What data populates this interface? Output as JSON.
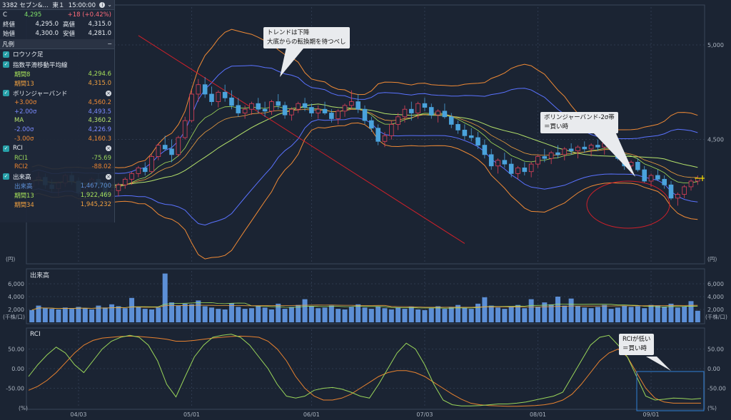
{
  "header": {
    "title": "3382 セブン&…",
    "market": "東１",
    "time": "15:00:00",
    "last_label": "C",
    "last": "4,295",
    "change": "+18 (+0.42%)",
    "close_label": "終値",
    "close": "4,295.0",
    "high_label": "高値",
    "high": "4,315.0",
    "open_label": "始値",
    "open": "4,300.0",
    "low_label": "安値",
    "low": "4,281.0"
  },
  "legend": {
    "title": "凡例",
    "candle": "ロウソク足",
    "ema": {
      "label": "指数平滑移動平均線",
      "p8_label": "期間8",
      "p8": "4,294.6",
      "p13_label": "期間13",
      "p13": "4,315.0"
    },
    "bb": {
      "label": "ボリンジャーバンド",
      "p3_label": "+3.00σ",
      "p3": "4,560.2",
      "p2_label": "+2.00σ",
      "p2": "4,493.5",
      "ma_label": "MA",
      "ma": "4,360.2",
      "m2_label": "-2.00σ",
      "m2": "4,226.9",
      "m3_label": "-3.00σ",
      "m3": "4,160.3"
    },
    "rci": {
      "label": "RCI",
      "r1_label": "RCI1",
      "r1": "-75.69",
      "r2_label": "RCI2",
      "r2": "-88.02"
    },
    "vol": {
      "label": "出来高",
      "v_label": "出来高",
      "v": "1,467,700",
      "p13_label": "期間13",
      "p13": "1,922,469",
      "p34_label": "期間34",
      "p34": "1,945,232"
    }
  },
  "colors": {
    "bg": "#1b2433",
    "up": "#e0415a",
    "down": "#4aa3dc",
    "bb3": "#f08a35",
    "bb2": "#5a72ff",
    "ma": "#b5e36b",
    "ema8": "#a6e05a",
    "ema13": "#f0a040",
    "rci1": "#9ad65a",
    "rci2": "#e8822f",
    "vol": "#5c8fd6",
    "trend": "#d0202a"
  },
  "callouts": {
    "trend": [
      "トレンドは下降",
      "大底からの転換期を待つべし"
    ],
    "bb": [
      "ボリンジャーバンド-2σ帯",
      "＝買い時"
    ],
    "rci": [
      "RCIが低い",
      "＝買い時"
    ]
  },
  "panels": {
    "volume_title": "出来高",
    "rci_title": "RCI",
    "price_unit": "(円)",
    "volume_unit": "(千株/口)",
    "rci_unit": "(%)"
  },
  "chart_data": {
    "type": "candlestick",
    "x_ticks": [
      "04/03",
      "05/01",
      "06/01",
      "07/03",
      "08/01",
      "09/01"
    ],
    "price_axis": {
      "ticks": [
        4500,
        5000
      ],
      "tick_labels": [
        "4,500",
        "5,000"
      ],
      "range": [
        3850,
        5200
      ]
    },
    "candles": [
      [
        4250,
        4300,
        4230,
        4280
      ],
      [
        4290,
        4330,
        4260,
        4300
      ],
      [
        4300,
        4320,
        4240,
        4260
      ],
      [
        4260,
        4290,
        4220,
        4240
      ],
      [
        4240,
        4280,
        4200,
        4270
      ],
      [
        4270,
        4320,
        4250,
        4310
      ],
      [
        4310,
        4330,
        4260,
        4280
      ],
      [
        4280,
        4300,
        4200,
        4220
      ],
      [
        4220,
        4260,
        4190,
        4250
      ],
      [
        4250,
        4300,
        4230,
        4290
      ],
      [
        4290,
        4320,
        4240,
        4260
      ],
      [
        4260,
        4280,
        4190,
        4200
      ],
      [
        4200,
        4240,
        4170,
        4230
      ],
      [
        4230,
        4270,
        4200,
        4260
      ],
      [
        4260,
        4300,
        4240,
        4290
      ],
      [
        4290,
        4330,
        4260,
        4320
      ],
      [
        4320,
        4360,
        4300,
        4350
      ],
      [
        4350,
        4380,
        4310,
        4330
      ],
      [
        4330,
        4420,
        4320,
        4410
      ],
      [
        4410,
        4480,
        4390,
        4470
      ],
      [
        4470,
        4520,
        4440,
        4450
      ],
      [
        4450,
        4500,
        4380,
        4420
      ],
      [
        4420,
        4520,
        4410,
        4510
      ],
      [
        4510,
        4620,
        4500,
        4600
      ],
      [
        4600,
        4760,
        4590,
        4740
      ],
      [
        4740,
        4820,
        4700,
        4790
      ],
      [
        4790,
        4830,
        4720,
        4740
      ],
      [
        4740,
        4780,
        4680,
        4700
      ],
      [
        4700,
        4760,
        4670,
        4750
      ],
      [
        4750,
        4790,
        4700,
        4720
      ],
      [
        4720,
        4760,
        4660,
        4680
      ],
      [
        4680,
        4720,
        4620,
        4640
      ],
      [
        4640,
        4680,
        4610,
        4660
      ],
      [
        4660,
        4700,
        4630,
        4690
      ],
      [
        4690,
        4720,
        4640,
        4660
      ],
      [
        4660,
        4700,
        4620,
        4650
      ],
      [
        4650,
        4710,
        4630,
        4700
      ],
      [
        4700,
        4740,
        4660,
        4680
      ],
      [
        4680,
        4700,
        4610,
        4630
      ],
      [
        4630,
        4670,
        4600,
        4660
      ],
      [
        4660,
        4700,
        4640,
        4690
      ],
      [
        4690,
        4720,
        4650,
        4670
      ],
      [
        4670,
        4690,
        4620,
        4640
      ],
      [
        4640,
        4680,
        4610,
        4660
      ],
      [
        4660,
        4700,
        4630,
        4640
      ],
      [
        4640,
        4660,
        4590,
        4610
      ],
      [
        4610,
        4660,
        4580,
        4650
      ],
      [
        4650,
        4690,
        4620,
        4680
      ],
      [
        4680,
        4760,
        4660,
        4700
      ],
      [
        4700,
        4740,
        4640,
        4660
      ],
      [
        4660,
        4680,
        4580,
        4600
      ],
      [
        4600,
        4620,
        4540,
        4560
      ],
      [
        4560,
        4580,
        4470,
        4490
      ],
      [
        4490,
        4540,
        4460,
        4520
      ],
      [
        4520,
        4600,
        4500,
        4580
      ],
      [
        4580,
        4640,
        4550,
        4620
      ],
      [
        4620,
        4680,
        4590,
        4660
      ],
      [
        4660,
        4700,
        4600,
        4640
      ],
      [
        4640,
        4700,
        4610,
        4690
      ],
      [
        4690,
        4720,
        4650,
        4670
      ],
      [
        4670,
        4690,
        4610,
        4630
      ],
      [
        4630,
        4660,
        4590,
        4650
      ],
      [
        4650,
        4690,
        4610,
        4620
      ],
      [
        4620,
        4640,
        4560,
        4580
      ],
      [
        4580,
        4600,
        4530,
        4550
      ],
      [
        4550,
        4580,
        4500,
        4520
      ],
      [
        4520,
        4560,
        4490,
        4510
      ],
      [
        4510,
        4540,
        4450,
        4470
      ],
      [
        4470,
        4500,
        4400,
        4420
      ],
      [
        4420,
        4450,
        4340,
        4360
      ],
      [
        4360,
        4400,
        4320,
        4390
      ],
      [
        4390,
        4430,
        4350,
        4370
      ],
      [
        4370,
        4400,
        4300,
        4320
      ],
      [
        4320,
        4360,
        4290,
        4350
      ],
      [
        4350,
        4380,
        4310,
        4330
      ],
      [
        4330,
        4380,
        4300,
        4370
      ],
      [
        4370,
        4420,
        4350,
        4410
      ],
      [
        4410,
        4450,
        4380,
        4400
      ],
      [
        4400,
        4440,
        4370,
        4430
      ],
      [
        4430,
        4470,
        4400,
        4420
      ],
      [
        4420,
        4460,
        4390,
        4450
      ],
      [
        4450,
        4480,
        4420,
        4440
      ],
      [
        4440,
        4470,
        4400,
        4460
      ],
      [
        4460,
        4490,
        4430,
        4450
      ],
      [
        4450,
        4480,
        4410,
        4470
      ],
      [
        4470,
        4500,
        4440,
        4460
      ],
      [
        4460,
        4490,
        4420,
        4480
      ],
      [
        4480,
        4520,
        4440,
        4450
      ],
      [
        4450,
        4470,
        4390,
        4400
      ],
      [
        4400,
        4420,
        4340,
        4360
      ],
      [
        4360,
        4390,
        4320,
        4380
      ],
      [
        4380,
        4400,
        4330,
        4340
      ],
      [
        4340,
        4360,
        4270,
        4280
      ],
      [
        4280,
        4320,
        4250,
        4310
      ],
      [
        4310,
        4340,
        4280,
        4290
      ],
      [
        4290,
        4310,
        4240,
        4260
      ],
      [
        4260,
        4280,
        4180,
        4190
      ],
      [
        4190,
        4220,
        4150,
        4210
      ],
      [
        4210,
        4260,
        4190,
        4250
      ],
      [
        4250,
        4290,
        4230,
        4280
      ],
      [
        4280,
        4310,
        4260,
        4295
      ]
    ],
    "volume": {
      "ticks": [
        2000,
        4000,
        6000
      ],
      "tick_labels": [
        "2,000",
        "4,000",
        "6,000"
      ],
      "range": [
        0,
        8000
      ],
      "values": [
        1900,
        2600,
        2200,
        2100,
        2000,
        2300,
        2100,
        2400,
        2200,
        2000,
        2600,
        2300,
        2800,
        2500,
        2200,
        3800,
        2400,
        2100,
        2000,
        2300,
        7600,
        3100,
        2600,
        2900,
        2800,
        3400,
        2500,
        2300,
        2100,
        2000,
        3000,
        2400,
        2100,
        2200,
        2600,
        2300,
        2000,
        2900,
        2100,
        2400,
        2700,
        3600,
        2500,
        2200,
        2300,
        2600,
        2100,
        2000,
        2400,
        2800,
        2300,
        2100,
        2500,
        2200,
        2000,
        2300,
        2100,
        2400,
        2000,
        1900,
        2200,
        2500,
        2100,
        2400,
        2700,
        2300,
        2100,
        2900,
        3900,
        2600,
        2300,
        2100,
        2400,
        2700,
        2200,
        3600,
        2400,
        3100,
        2800,
        4000,
        2600,
        3700,
        2500,
        2300,
        2200,
        2400,
        2700,
        2100,
        2300,
        2600,
        2400,
        2500,
        2200,
        2700,
        2600,
        2400,
        2900,
        2300,
        2500,
        3300,
        1800
      ]
    },
    "rci": {
      "ticks": [
        -50,
        0,
        50
      ],
      "tick_labels": [
        "-50.00",
        "0.00",
        "50.00"
      ],
      "range": [
        -100,
        100
      ],
      "rci1": [
        -20,
        10,
        35,
        55,
        40,
        10,
        -10,
        20,
        50,
        70,
        80,
        85,
        80,
        60,
        20,
        -40,
        -72,
        -20,
        30,
        60,
        80,
        85,
        88,
        80,
        60,
        30,
        0,
        -40,
        -70,
        -75,
        -70,
        -55,
        -50,
        -48,
        -52,
        -60,
        -70,
        -75,
        -40,
        0,
        40,
        65,
        50,
        10,
        -40,
        -80,
        -92,
        -95,
        -95,
        -94,
        -92,
        -90,
        -90,
        -88,
        -85,
        -80,
        -75,
        -70,
        -60,
        -20,
        20,
        60,
        80,
        85,
        60,
        30,
        -20,
        -70,
        -80,
        -78,
        -75,
        -76,
        -78,
        -76
      ],
      "rci2": [
        -55,
        -45,
        -30,
        -10,
        15,
        40,
        60,
        72,
        78,
        80,
        82,
        83,
        82,
        80,
        78,
        75,
        70,
        70,
        72,
        75,
        78,
        80,
        82,
        83,
        82,
        80,
        70,
        50,
        20,
        -20,
        -50,
        -70,
        -80,
        -80,
        -75,
        -65,
        -50,
        -35,
        -20,
        -10,
        -5,
        -5,
        -10,
        -20,
        -35,
        -50,
        -65,
        -78,
        -88,
        -92,
        -94,
        -95,
        -96,
        -96,
        -95,
        -94,
        -92,
        -88,
        -80,
        -65,
        -40,
        -10,
        20,
        40,
        50,
        30,
        -10,
        -50,
        -75,
        -85,
        -88,
        -88,
        -88,
        -88
      ]
    }
  }
}
